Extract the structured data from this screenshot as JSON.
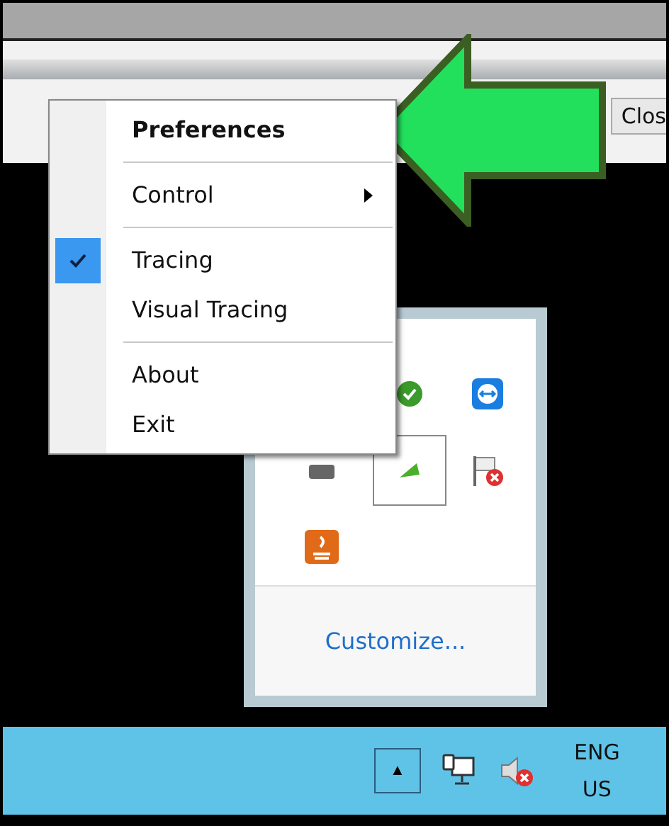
{
  "window": {
    "close_button": "Clos"
  },
  "context_menu": {
    "items": [
      {
        "kind": "item",
        "label": "Preferences",
        "bold": true,
        "checked": false,
        "submenu": false
      },
      {
        "kind": "separator"
      },
      {
        "kind": "item",
        "label": "Control",
        "bold": false,
        "checked": false,
        "submenu": true
      },
      {
        "kind": "separator"
      },
      {
        "kind": "item",
        "label": "Tracing",
        "bold": false,
        "checked": true,
        "submenu": false
      },
      {
        "kind": "item",
        "label": "Visual Tracing",
        "bold": false,
        "checked": false,
        "submenu": false
      },
      {
        "kind": "separator"
      },
      {
        "kind": "item",
        "label": "About",
        "bold": false,
        "checked": false,
        "submenu": false
      },
      {
        "kind": "item",
        "label": "Exit",
        "bold": false,
        "checked": false,
        "submenu": false
      }
    ]
  },
  "tray_overflow": {
    "link": "Customize..."
  },
  "taskbar": {
    "show_hidden_button": "▲",
    "language": [
      "ENG",
      "US"
    ]
  }
}
